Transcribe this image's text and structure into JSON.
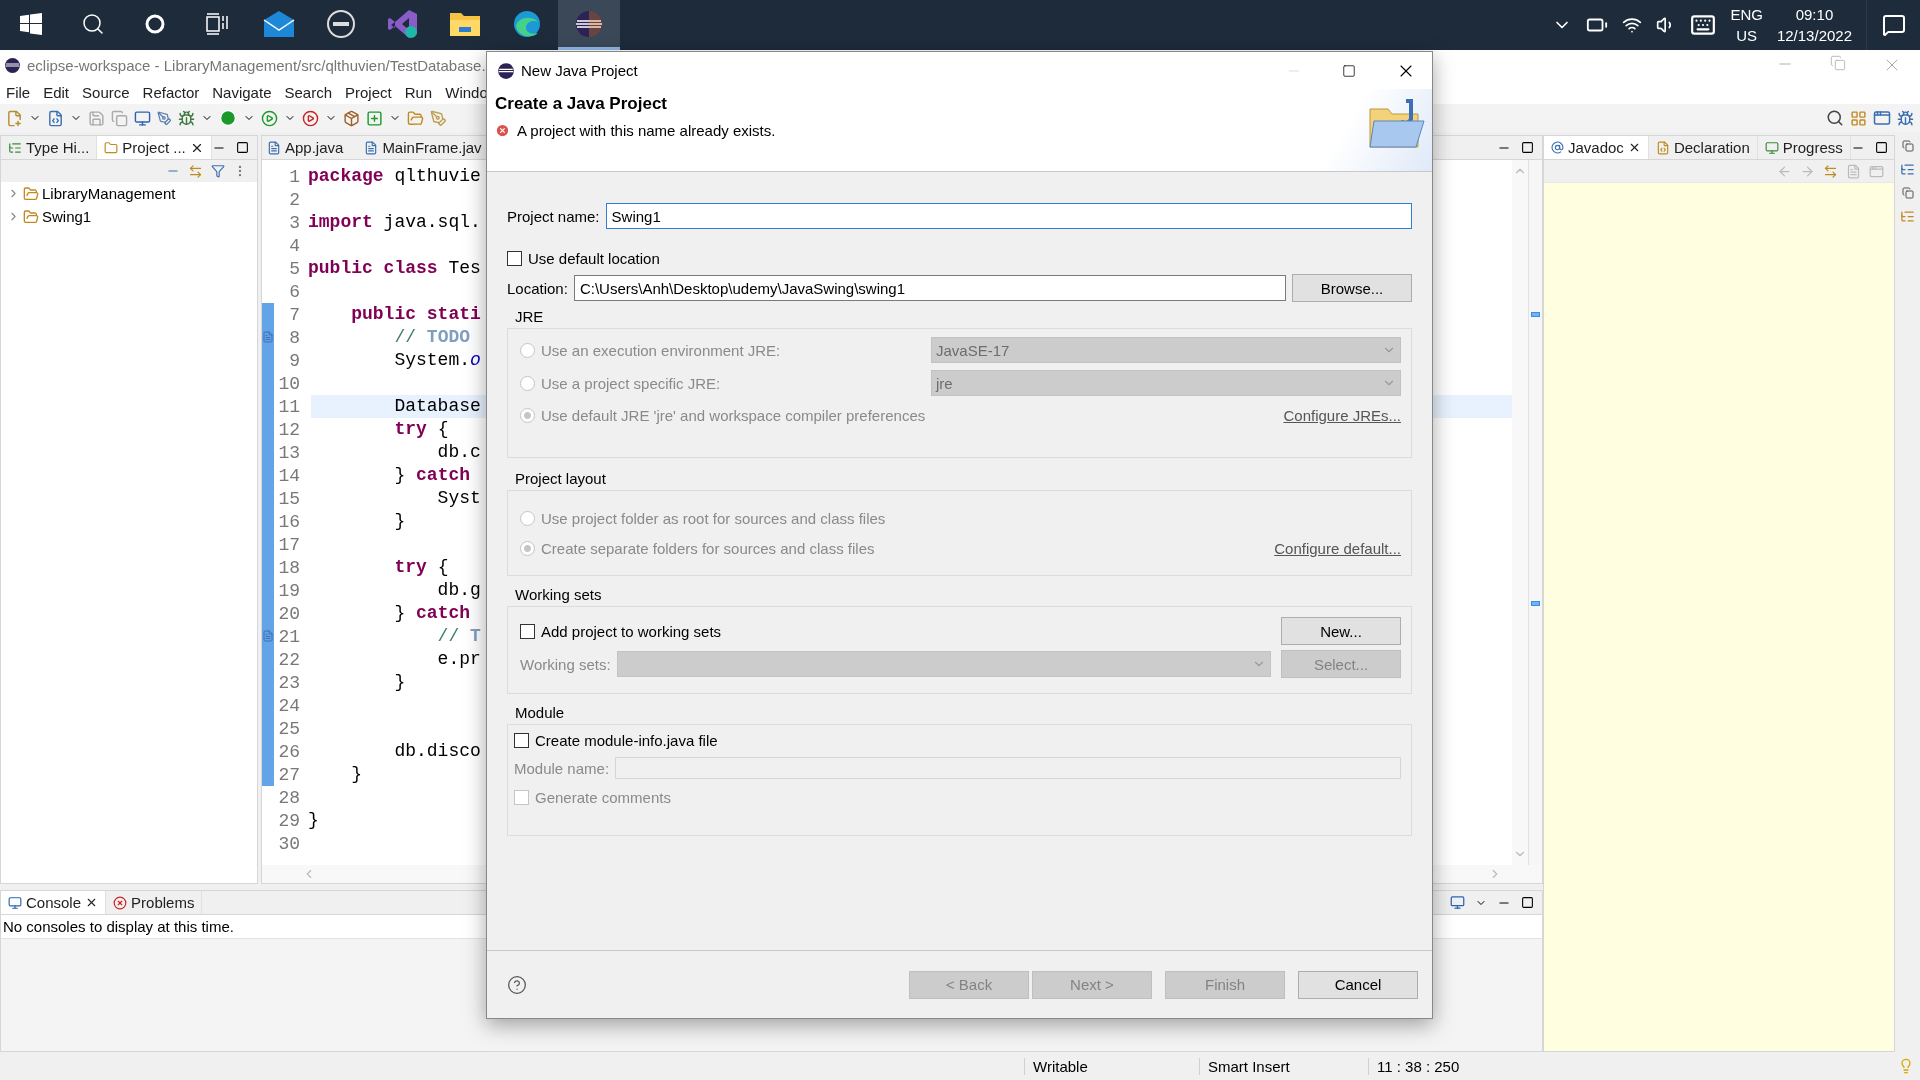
{
  "taskbar": {
    "apps": [
      {
        "kind": "start",
        "selected": false
      },
      {
        "kind": "search",
        "selected": false
      },
      {
        "kind": "cortana",
        "selected": false
      },
      {
        "kind": "taskview",
        "selected": false
      },
      {
        "kind": "mail",
        "selected": false
      },
      {
        "kind": "dell",
        "selected": false
      },
      {
        "kind": "studio",
        "selected": false
      },
      {
        "kind": "explorer",
        "selected": false
      },
      {
        "kind": "edge",
        "selected": false
      },
      {
        "kind": "eclipse",
        "selected": true
      }
    ],
    "language": "ENG",
    "region": "US",
    "time": "09:10",
    "date": "12/13/2022"
  },
  "window": {
    "title": "eclipse-workspace - LibraryManagement/src/qlthuvien/TestDatabase."
  },
  "menu": [
    "File",
    "Edit",
    "Source",
    "Refactor",
    "Navigate",
    "Search",
    "Project",
    "Run",
    "Windo"
  ],
  "left_panel": {
    "tabs": [
      {
        "label": "Type Hi...",
        "selected": false
      },
      {
        "label": "Project ...",
        "selected": true
      }
    ],
    "tree": [
      {
        "label": "LibraryManagement",
        "expanded": false
      },
      {
        "label": "Swing1",
        "expanded": false
      }
    ]
  },
  "editor": {
    "tabs": [
      {
        "label": "App.java",
        "selected": false
      },
      {
        "label": "MainFrame.jav",
        "selected": false
      }
    ],
    "lines": [
      {
        "number": "1",
        "changed": false,
        "current": false,
        "segments": [
          {
            "kind": "keyword",
            "text": "package"
          },
          {
            "kind": "plain",
            "text": " qlthuvie"
          }
        ]
      },
      {
        "number": "2",
        "changed": false,
        "current": false
      },
      {
        "number": "3",
        "changed": false,
        "current": false,
        "segments": [
          {
            "kind": "keyword",
            "text": "import"
          },
          {
            "kind": "plain",
            "text": " java.sql."
          }
        ]
      },
      {
        "number": "4",
        "changed": false,
        "current": false
      },
      {
        "number": "5",
        "changed": false,
        "current": false,
        "segments": [
          {
            "kind": "keyword",
            "text": "public class"
          },
          {
            "kind": "plain",
            "text": " Tes"
          }
        ]
      },
      {
        "number": "6",
        "changed": false,
        "current": false
      },
      {
        "number": "7",
        "changed": true,
        "current": false,
        "segments": [
          {
            "kind": "keyword",
            "text": "    public stati"
          }
        ]
      },
      {
        "number": "8",
        "changed": true,
        "current": false,
        "segments": [
          {
            "kind": "comment",
            "text": "        // "
          },
          {
            "kind": "task",
            "text": "TODO"
          }
        ]
      },
      {
        "number": "9",
        "changed": true,
        "current": false,
        "segments": [
          {
            "kind": "plain",
            "text": "        System."
          },
          {
            "kind": "field",
            "text": "o"
          }
        ]
      },
      {
        "number": "10",
        "changed": true,
        "current": false
      },
      {
        "number": "11",
        "changed": true,
        "current": true,
        "segments": [
          {
            "kind": "plain",
            "text": "        Database"
          }
        ]
      },
      {
        "number": "12",
        "changed": true,
        "current": false,
        "segments": [
          {
            "kind": "keyword",
            "text": "        try"
          },
          {
            "kind": "plain",
            "text": " {"
          }
        ]
      },
      {
        "number": "13",
        "changed": true,
        "current": false,
        "segments": [
          {
            "kind": "plain",
            "text": "            db.c"
          }
        ]
      },
      {
        "number": "14",
        "changed": true,
        "current": false,
        "segments": [
          {
            "kind": "plain",
            "text": "        } "
          },
          {
            "kind": "keyword",
            "text": "catch"
          }
        ]
      },
      {
        "number": "15",
        "changed": true,
        "current": false,
        "segments": [
          {
            "kind": "plain",
            "text": "            Syst"
          }
        ]
      },
      {
        "number": "16",
        "changed": true,
        "current": false,
        "segments": [
          {
            "kind": "plain",
            "text": "        }"
          }
        ]
      },
      {
        "number": "17",
        "changed": true,
        "current": false
      },
      {
        "number": "18",
        "changed": true,
        "current": false,
        "segments": [
          {
            "kind": "keyword",
            "text": "        try"
          },
          {
            "kind": "plain",
            "text": " {"
          }
        ]
      },
      {
        "number": "19",
        "changed": true,
        "current": false,
        "segments": [
          {
            "kind": "plain",
            "text": "            db.g"
          }
        ]
      },
      {
        "number": "20",
        "changed": true,
        "current": false,
        "segments": [
          {
            "kind": "plain",
            "text": "        } "
          },
          {
            "kind": "keyword",
            "text": "catch"
          }
        ]
      },
      {
        "number": "21",
        "changed": true,
        "current": false,
        "segments": [
          {
            "kind": "comment",
            "text": "            // "
          },
          {
            "kind": "task",
            "text": "T"
          }
        ]
      },
      {
        "number": "22",
        "changed": true,
        "current": false,
        "segments": [
          {
            "kind": "plain",
            "text": "            e.pr"
          }
        ]
      },
      {
        "number": "23",
        "changed": true,
        "current": false,
        "segments": [
          {
            "kind": "plain",
            "text": "        }"
          }
        ]
      },
      {
        "number": "24",
        "changed": true,
        "current": false
      },
      {
        "number": "25",
        "changed": true,
        "current": false
      },
      {
        "number": "26",
        "changed": true,
        "current": false,
        "segments": [
          {
            "kind": "plain",
            "text": "        db.disco"
          }
        ]
      },
      {
        "number": "27",
        "changed": true,
        "current": false,
        "segments": [
          {
            "kind": "plain",
            "text": "    }"
          }
        ]
      },
      {
        "number": "28",
        "changed": false,
        "current": false
      },
      {
        "number": "29",
        "changed": false,
        "current": false,
        "segments": [
          {
            "kind": "plain",
            "text": "}"
          }
        ]
      },
      {
        "number": "30",
        "changed": false,
        "current": false
      }
    ]
  },
  "right_panel": {
    "tabs": [
      {
        "label": "Javadoc",
        "selected": true
      },
      {
        "label": "Declaration",
        "selected": false
      },
      {
        "label": "Progress",
        "selected": false
      }
    ]
  },
  "bottom_panel": {
    "tabs": [
      {
        "label": "Console",
        "selected": true
      },
      {
        "label": "Problems",
        "selected": false
      }
    ],
    "message": "No consoles to display at this time."
  },
  "status_bar": [
    "Writable",
    "Smart Insert",
    "11 : 38 : 250"
  ],
  "dialog": {
    "title": "New Java Project",
    "heading": "Create a Java Project",
    "error": "A project with this name already exists.",
    "project_name": {
      "label": "Project name:",
      "value": "Swing1"
    },
    "use_default_location": {
      "label": "Use default location",
      "checked": false
    },
    "location": {
      "label": "Location:",
      "value": "C:\\Users\\Anh\\Desktop\\udemy\\JavaSwing\\swing1",
      "button": "Browse..."
    },
    "jre": {
      "title": "JRE",
      "options": [
        {
          "label": "Use an execution environment JRE:",
          "selected": false,
          "disabled": true,
          "select_value": "JavaSE-17"
        },
        {
          "label": "Use a project specific JRE:",
          "selected": false,
          "disabled": true,
          "select_value": "jre"
        },
        {
          "label": "Use default JRE 'jre' and workspace compiler preferences",
          "selected": true,
          "disabled": true,
          "link": "Configure JREs..."
        }
      ]
    },
    "project_layout": {
      "title": "Project layout",
      "options": [
        {
          "label": "Use project folder as root for sources and class files",
          "selected": false,
          "disabled": true
        },
        {
          "label": "Create separate folders for sources and class files",
          "selected": true,
          "disabled": true,
          "link": "Configure default..."
        }
      ]
    },
    "working_sets": {
      "title": "Working sets",
      "checkbox": {
        "label": "Add project to working sets",
        "checked": false
      },
      "new_button": {
        "label": "New...",
        "disabled": false
      },
      "sets_field": {
        "label": "Working sets:",
        "disabled": true
      },
      "select_button": {
        "label": "Select...",
        "disabled": true
      }
    },
    "module": {
      "title": "Module",
      "checkbox": {
        "label": "Create module-info.java file",
        "checked": false
      },
      "name_field": {
        "label": "Module name:",
        "disabled": true
      },
      "comments": {
        "label": "Generate comments",
        "checked": false,
        "disabled": true
      }
    },
    "buttons": [
      {
        "label": "< Back",
        "disabled": true
      },
      {
        "label": "Next >",
        "disabled": true
      },
      {
        "label": "Finish",
        "disabled": true
      },
      {
        "label": "Cancel",
        "disabled": false
      }
    ]
  }
}
